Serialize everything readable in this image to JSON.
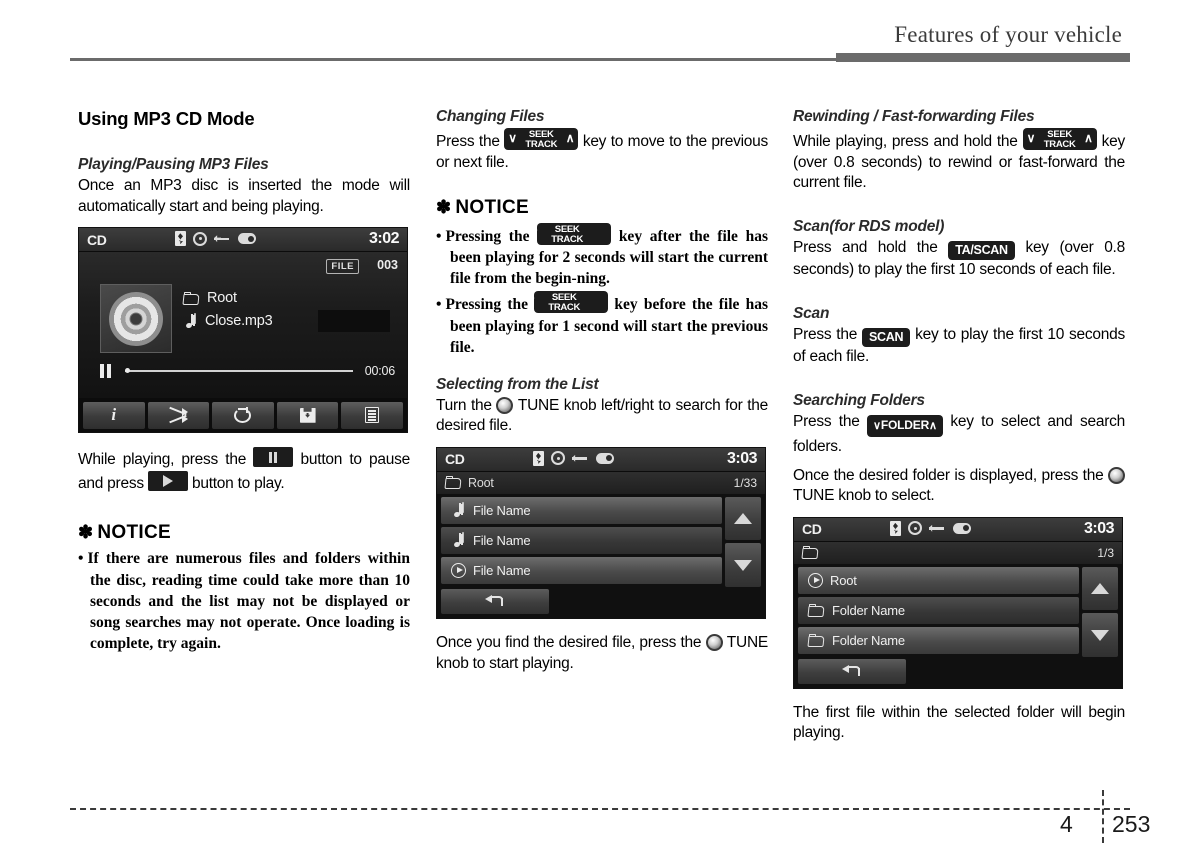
{
  "header": {
    "title": "Features of your vehicle"
  },
  "footer": {
    "chapter": "4",
    "page": "253"
  },
  "column1": {
    "section_title": "Using MP3 CD Mode",
    "playing_pausing": {
      "heading": "Playing/Pausing MP3 Files",
      "body": "Once an MP3 disc is inserted the mode will automatically start and being playing."
    },
    "lcd_now_playing": {
      "source": "CD",
      "time": "3:02",
      "status_icons": [
        "bluetooth-icon",
        "disc-icon",
        "usb-icon",
        "aux-icon"
      ],
      "file_badge": "FILE",
      "file_number": "003",
      "folder": "Root",
      "track": "Close.mp3",
      "elapsed": "00:06",
      "transport_state": "pause-icon",
      "toolbar": [
        "info-icon",
        "shuffle-icon",
        "repeat-icon",
        "save-icon",
        "list-icon"
      ]
    },
    "pause_play_text": {
      "part1": "While playing, press the",
      "part2": "button to pause and press",
      "part3": "button to play.",
      "pause_glyph": "pause-icon",
      "play_glyph": "play-icon"
    },
    "notice": {
      "heading": "NOTICE",
      "star": "✽",
      "items": [
        "If there are numerous files and folders within the disc, reading time could take more than 10 seconds and the list may not be displayed or song searches may not operate. Once loading is complete, try again."
      ]
    }
  },
  "column2": {
    "changing_files": {
      "heading": "Changing Files",
      "part1": "Press the",
      "part2": "key to move to the previous or next file.",
      "key": {
        "line1": "SEEK",
        "line2": "TRACK",
        "chev_left": "∨",
        "chev_right": "∧"
      }
    },
    "notice": {
      "heading": "NOTICE",
      "star": "✽",
      "item1_part1": "Pressing the",
      "item1_part2": "key after the file has been playing for 2 seconds will start the current file from the begin-ning.",
      "item2_part1": "Pressing the",
      "item2_part2": "key before the file has been playing for 1 second will start the previous file.",
      "key": {
        "line1": "SEEK",
        "line2": "TRACK",
        "chev_left": "∨"
      }
    },
    "selecting_list": {
      "heading": "Selecting from the List",
      "part1": "Turn the",
      "part2": "TUNE knob left/right to search for the desired file.",
      "knob": "tune-knob-icon"
    },
    "lcd_file_list": {
      "source": "CD",
      "time": "3:03",
      "path": "Root",
      "page_count": "1/33",
      "rows": [
        {
          "icon": "music-note-icon",
          "label": "File Name",
          "state": "normal"
        },
        {
          "icon": "music-note-icon",
          "label": "File Name",
          "state": "dim"
        },
        {
          "icon": "play-circle-icon",
          "label": "File Name",
          "state": "normal"
        }
      ],
      "scroll_up": "arrow-up-icon",
      "scroll_down": "arrow-down-icon",
      "back": "back-icon"
    },
    "after_list_text": "Once you find the desired file, press the",
    "after_list_text2": "TUNE knob to start playing."
  },
  "column3": {
    "rewinding": {
      "heading": "Rewinding / Fast-forwarding Files",
      "part1": "While playing, press and hold the",
      "part2": "key (over 0.8 seconds) to rewind or fast-forward the current file.",
      "key": {
        "line1": "SEEK",
        "line2": "TRACK",
        "chev_left": "∨",
        "chev_right": "∧"
      }
    },
    "scan_rds": {
      "heading": "Scan(for RDS model)",
      "part1": "Press and hold the",
      "part2": "key (over 0.8 seconds) to play the first 10 seconds of each file.",
      "key_label": "TA/SCAN"
    },
    "scan": {
      "heading": "Scan",
      "part1": "Press the",
      "part2": "key to play the first 10 seconds of each file.",
      "key_label": "SCAN"
    },
    "searching_folders": {
      "heading": "Searching Folders",
      "part1": "Press the",
      "part2": "key to select and search folders.",
      "key": {
        "label": "FOLDER",
        "chev_left": "∨",
        "chev_right": "∧"
      },
      "para2_part1": "Once the desired folder is displayed, press the",
      "para2_part2": "TUNE knob to select."
    },
    "lcd_folder_list": {
      "source": "CD",
      "time": "3:03",
      "path": "",
      "page_count": "1/3",
      "rows": [
        {
          "icon": "play-circle-icon",
          "label": "Root",
          "state": "normal"
        },
        {
          "icon": "folder-icon",
          "label": "Folder Name",
          "state": "dim"
        },
        {
          "icon": "folder-icon",
          "label": "Folder Name",
          "state": "normal"
        }
      ],
      "scroll_up": "arrow-up-icon",
      "scroll_down": "arrow-down-icon",
      "back": "back-icon"
    },
    "closing_text": "The first file within the selected folder will begin playing."
  }
}
